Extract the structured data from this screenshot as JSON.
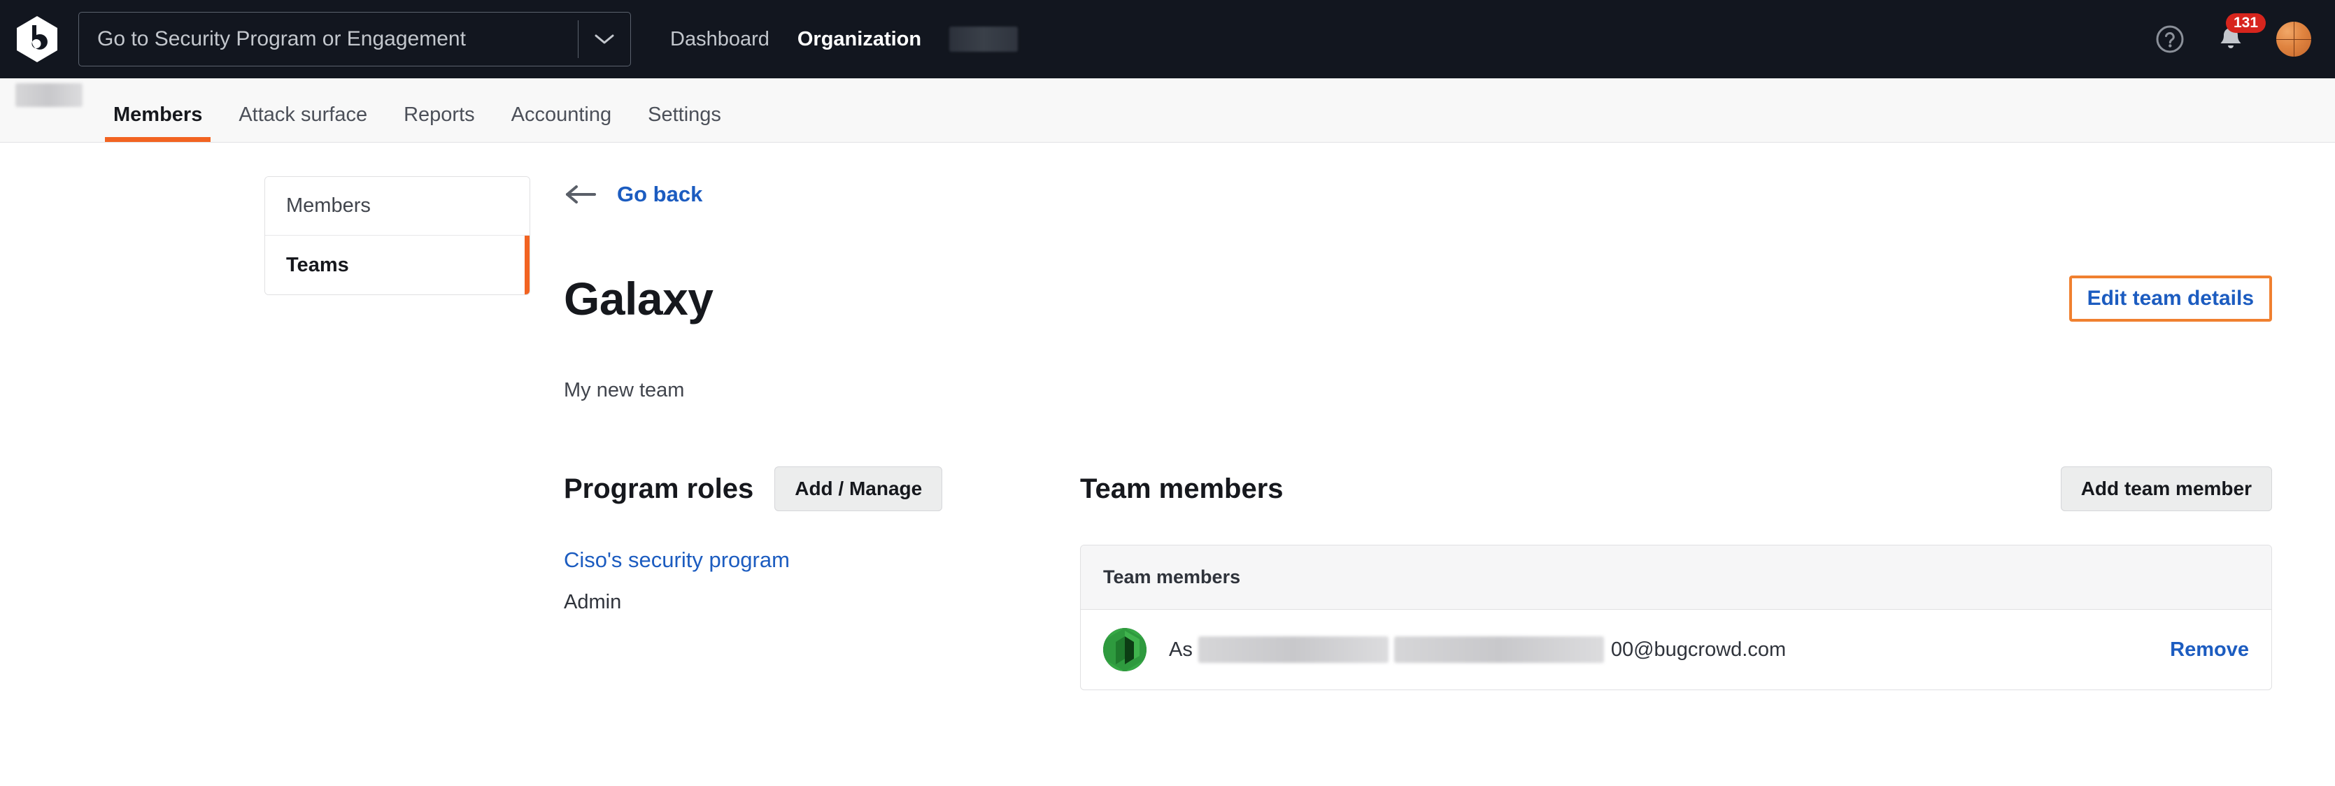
{
  "topbar": {
    "logo_icon": "bugcrowd-logo-icon",
    "program_select": {
      "label": "Go to Security Program or Engagement",
      "caret_icon": "chevron-down-icon"
    },
    "nav": [
      {
        "label": "Dashboard",
        "active": false
      },
      {
        "label": "Organization",
        "active": true
      }
    ],
    "org_name_redacted": "",
    "help_icon": "help-circle-icon",
    "notifications": {
      "icon": "bell-icon",
      "count": "131",
      "badge_color": "#d7251d"
    },
    "avatar_icon": "basketball-avatar-icon"
  },
  "subnav": {
    "org_label_redacted": "",
    "items": [
      {
        "label": "Members",
        "active": true
      },
      {
        "label": "Attack surface",
        "active": false
      },
      {
        "label": "Reports",
        "active": false
      },
      {
        "label": "Accounting",
        "active": false
      },
      {
        "label": "Settings",
        "active": false
      }
    ],
    "active_accent": "#f26321"
  },
  "sidebar": {
    "items": [
      {
        "label": "Members",
        "active": false
      },
      {
        "label": "Teams",
        "active": true
      }
    ],
    "active_accent": "#f26321"
  },
  "main": {
    "go_back": {
      "label": "Go back",
      "icon": "arrow-left-icon"
    },
    "team_title": "Galaxy",
    "team_subtitle": "My new team",
    "edit_team_details": {
      "label": "Edit team details",
      "focus_ring_color": "#f08030",
      "text_color": "#1c5cc0"
    },
    "program_roles": {
      "title": "Program roles",
      "manage_button": "Add / Manage",
      "entries": [
        {
          "program": "Ciso's security program",
          "role": "Admin"
        }
      ]
    },
    "team_members": {
      "title": "Team members",
      "add_button": "Add team member",
      "table_header": "Team members",
      "rows": [
        {
          "avatar_icon": "green-identicon-avatar",
          "email_prefix": "As",
          "email_suffix": "00@bugcrowd.com",
          "remove_label": "Remove"
        }
      ]
    }
  }
}
